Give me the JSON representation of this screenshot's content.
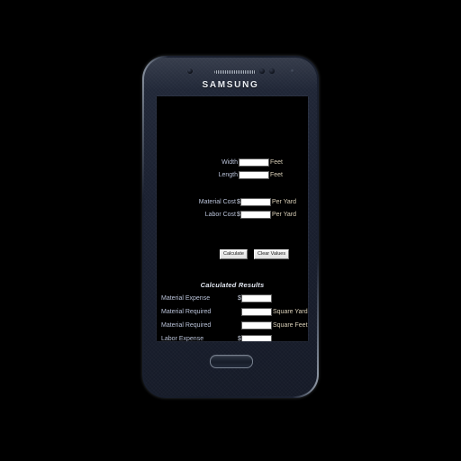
{
  "device": {
    "brand": "SAMSUNG",
    "icons": {
      "front_camera": "camera-icon",
      "earpiece": "speaker-grille-icon",
      "proximity_sensor": "sensor-icon",
      "light_sensor": "sensor-icon",
      "led_indicator": "led-icon",
      "home_button": "home-button"
    }
  },
  "app": {
    "inputs": [
      {
        "label": "Width",
        "prefix": "",
        "value": "",
        "unit": "Feet"
      },
      {
        "label": "Length",
        "prefix": "",
        "value": "",
        "unit": "Feet"
      },
      {
        "label": "Material Cost",
        "prefix": "$",
        "value": "",
        "unit": "Per Yard"
      },
      {
        "label": "Labor Cost",
        "prefix": "$",
        "value": "",
        "unit": "Per Yard"
      }
    ],
    "buttons": {
      "calculate": "Calculate",
      "clear": "Clear Values"
    },
    "results_title": "Calculated Results",
    "results": [
      {
        "label": "Material Expense",
        "prefix": "$",
        "value": "",
        "unit": ""
      },
      {
        "label": "Material Required",
        "prefix": "",
        "value": "",
        "unit": "Square Yards"
      },
      {
        "label": "Material Required",
        "prefix": "",
        "value": "",
        "unit": "Square Feet"
      },
      {
        "label": "Labor Expense",
        "prefix": "$",
        "value": "",
        "unit": ""
      }
    ]
  },
  "colors": {
    "background": "#000000",
    "screen": "#000000",
    "label_text": "#b9c2d8",
    "unit_text": "#d9cfb8",
    "heading_text": "#e3e8f2",
    "field_fill": "#ffffff",
    "device_body": "#1a2030",
    "device_rim": "#9aa3b0"
  }
}
